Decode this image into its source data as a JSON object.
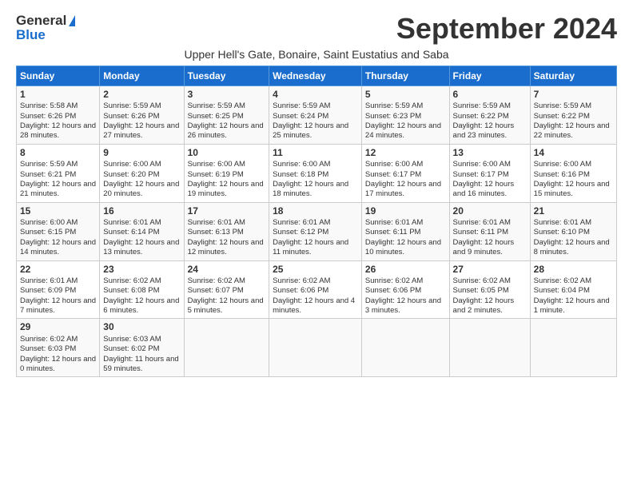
{
  "logo": {
    "general": "General",
    "blue": "Blue"
  },
  "title": "September 2024",
  "subtitle": "Upper Hell's Gate, Bonaire, Saint Eustatius and Saba",
  "days_of_week": [
    "Sunday",
    "Monday",
    "Tuesday",
    "Wednesday",
    "Thursday",
    "Friday",
    "Saturday"
  ],
  "weeks": [
    [
      {
        "day": "1",
        "sunrise": "Sunrise: 5:58 AM",
        "sunset": "Sunset: 6:26 PM",
        "daylight": "Daylight: 12 hours and 28 minutes."
      },
      {
        "day": "2",
        "sunrise": "Sunrise: 5:59 AM",
        "sunset": "Sunset: 6:26 PM",
        "daylight": "Daylight: 12 hours and 27 minutes."
      },
      {
        "day": "3",
        "sunrise": "Sunrise: 5:59 AM",
        "sunset": "Sunset: 6:25 PM",
        "daylight": "Daylight: 12 hours and 26 minutes."
      },
      {
        "day": "4",
        "sunrise": "Sunrise: 5:59 AM",
        "sunset": "Sunset: 6:24 PM",
        "daylight": "Daylight: 12 hours and 25 minutes."
      },
      {
        "day": "5",
        "sunrise": "Sunrise: 5:59 AM",
        "sunset": "Sunset: 6:23 PM",
        "daylight": "Daylight: 12 hours and 24 minutes."
      },
      {
        "day": "6",
        "sunrise": "Sunrise: 5:59 AM",
        "sunset": "Sunset: 6:22 PM",
        "daylight": "Daylight: 12 hours and 23 minutes."
      },
      {
        "day": "7",
        "sunrise": "Sunrise: 5:59 AM",
        "sunset": "Sunset: 6:22 PM",
        "daylight": "Daylight: 12 hours and 22 minutes."
      }
    ],
    [
      {
        "day": "8",
        "sunrise": "Sunrise: 5:59 AM",
        "sunset": "Sunset: 6:21 PM",
        "daylight": "Daylight: 12 hours and 21 minutes."
      },
      {
        "day": "9",
        "sunrise": "Sunrise: 6:00 AM",
        "sunset": "Sunset: 6:20 PM",
        "daylight": "Daylight: 12 hours and 20 minutes."
      },
      {
        "day": "10",
        "sunrise": "Sunrise: 6:00 AM",
        "sunset": "Sunset: 6:19 PM",
        "daylight": "Daylight: 12 hours and 19 minutes."
      },
      {
        "day": "11",
        "sunrise": "Sunrise: 6:00 AM",
        "sunset": "Sunset: 6:18 PM",
        "daylight": "Daylight: 12 hours and 18 minutes."
      },
      {
        "day": "12",
        "sunrise": "Sunrise: 6:00 AM",
        "sunset": "Sunset: 6:17 PM",
        "daylight": "Daylight: 12 hours and 17 minutes."
      },
      {
        "day": "13",
        "sunrise": "Sunrise: 6:00 AM",
        "sunset": "Sunset: 6:17 PM",
        "daylight": "Daylight: 12 hours and 16 minutes."
      },
      {
        "day": "14",
        "sunrise": "Sunrise: 6:00 AM",
        "sunset": "Sunset: 6:16 PM",
        "daylight": "Daylight: 12 hours and 15 minutes."
      }
    ],
    [
      {
        "day": "15",
        "sunrise": "Sunrise: 6:00 AM",
        "sunset": "Sunset: 6:15 PM",
        "daylight": "Daylight: 12 hours and 14 minutes."
      },
      {
        "day": "16",
        "sunrise": "Sunrise: 6:01 AM",
        "sunset": "Sunset: 6:14 PM",
        "daylight": "Daylight: 12 hours and 13 minutes."
      },
      {
        "day": "17",
        "sunrise": "Sunrise: 6:01 AM",
        "sunset": "Sunset: 6:13 PM",
        "daylight": "Daylight: 12 hours and 12 minutes."
      },
      {
        "day": "18",
        "sunrise": "Sunrise: 6:01 AM",
        "sunset": "Sunset: 6:12 PM",
        "daylight": "Daylight: 12 hours and 11 minutes."
      },
      {
        "day": "19",
        "sunrise": "Sunrise: 6:01 AM",
        "sunset": "Sunset: 6:11 PM",
        "daylight": "Daylight: 12 hours and 10 minutes."
      },
      {
        "day": "20",
        "sunrise": "Sunrise: 6:01 AM",
        "sunset": "Sunset: 6:11 PM",
        "daylight": "Daylight: 12 hours and 9 minutes."
      },
      {
        "day": "21",
        "sunrise": "Sunrise: 6:01 AM",
        "sunset": "Sunset: 6:10 PM",
        "daylight": "Daylight: 12 hours and 8 minutes."
      }
    ],
    [
      {
        "day": "22",
        "sunrise": "Sunrise: 6:01 AM",
        "sunset": "Sunset: 6:09 PM",
        "daylight": "Daylight: 12 hours and 7 minutes."
      },
      {
        "day": "23",
        "sunrise": "Sunrise: 6:02 AM",
        "sunset": "Sunset: 6:08 PM",
        "daylight": "Daylight: 12 hours and 6 minutes."
      },
      {
        "day": "24",
        "sunrise": "Sunrise: 6:02 AM",
        "sunset": "Sunset: 6:07 PM",
        "daylight": "Daylight: 12 hours and 5 minutes."
      },
      {
        "day": "25",
        "sunrise": "Sunrise: 6:02 AM",
        "sunset": "Sunset: 6:06 PM",
        "daylight": "Daylight: 12 hours and 4 minutes."
      },
      {
        "day": "26",
        "sunrise": "Sunrise: 6:02 AM",
        "sunset": "Sunset: 6:06 PM",
        "daylight": "Daylight: 12 hours and 3 minutes."
      },
      {
        "day": "27",
        "sunrise": "Sunrise: 6:02 AM",
        "sunset": "Sunset: 6:05 PM",
        "daylight": "Daylight: 12 hours and 2 minutes."
      },
      {
        "day": "28",
        "sunrise": "Sunrise: 6:02 AM",
        "sunset": "Sunset: 6:04 PM",
        "daylight": "Daylight: 12 hours and 1 minute."
      }
    ],
    [
      {
        "day": "29",
        "sunrise": "Sunrise: 6:02 AM",
        "sunset": "Sunset: 6:03 PM",
        "daylight": "Daylight: 12 hours and 0 minutes."
      },
      {
        "day": "30",
        "sunrise": "Sunrise: 6:03 AM",
        "sunset": "Sunset: 6:02 PM",
        "daylight": "Daylight: 11 hours and 59 minutes."
      },
      {
        "day": "",
        "sunrise": "",
        "sunset": "",
        "daylight": ""
      },
      {
        "day": "",
        "sunrise": "",
        "sunset": "",
        "daylight": ""
      },
      {
        "day": "",
        "sunrise": "",
        "sunset": "",
        "daylight": ""
      },
      {
        "day": "",
        "sunrise": "",
        "sunset": "",
        "daylight": ""
      },
      {
        "day": "",
        "sunrise": "",
        "sunset": "",
        "daylight": ""
      }
    ]
  ]
}
